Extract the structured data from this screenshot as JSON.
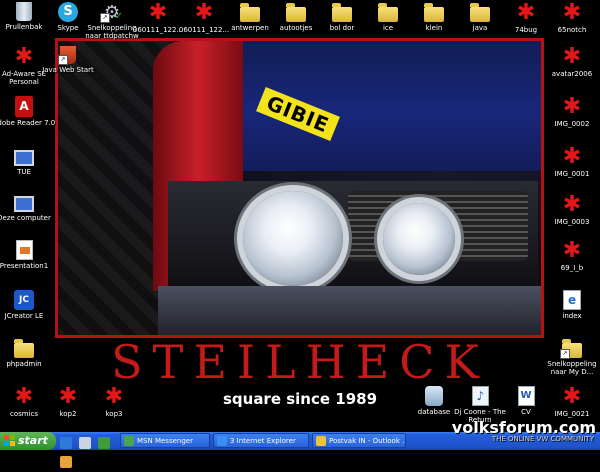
{
  "wallpaper": {
    "sticker_text": "GIBIE",
    "title": "STEILHECK",
    "subtitle": "square since 1989"
  },
  "watermark": {
    "main": "volksforum.com",
    "sub": "THE ONLINE VW COMMUNITY"
  },
  "desktop_icons": {
    "prullenbak": "Prullenbak",
    "skype": "Skype",
    "snelkoppeling_ttd": "Snelkoppeling naar ttdpatchw",
    "img_060111_a": "060111_122...",
    "img_060111_b": "060111_122...",
    "antwerpen": "antwerpen",
    "autootjes": "autootjes",
    "bol_dor": "bol dor",
    "ice": "ice",
    "klein": "klein",
    "java": "java",
    "bug74": "74bug",
    "sotch65": "65notch",
    "adaware": "Ad-Aware SE Personal",
    "javawebstart": "Java Web Start",
    "avatar2006": "avatar2006",
    "adobe": "Adobe Reader 7.0",
    "img_0002": "IMG_0002",
    "tue": "TUE",
    "img_0001": "IMG_0001",
    "mypc": "Deze computer",
    "img_0003": "IMG_0003",
    "presentation1": "Presentation1",
    "f69": "69_I_b",
    "jcreator": "JCreator LE",
    "index": "index",
    "phpadmin": "phpadmin",
    "snelkoppeling_my": "Snelkoppeling naar My D...",
    "cosmics": "cosmics",
    "kop2": "kop2",
    "kop3": "kop3",
    "database": "database",
    "djcoone": "Dj Coone - The Return",
    "cv": "CV",
    "img_0021": "IMG_0021"
  },
  "taskbar": {
    "start_label": "start",
    "tasks": [
      {
        "label": "MSN Messenger"
      },
      {
        "label": "3 Internet Explorer"
      },
      {
        "label": "Postvak IN - Outlook ..."
      }
    ]
  },
  "colors": {
    "title_red": "#c41a1a",
    "frame_red": "#b51313",
    "taskbar_blue": "#245edb",
    "start_green": "#3a9a34"
  }
}
